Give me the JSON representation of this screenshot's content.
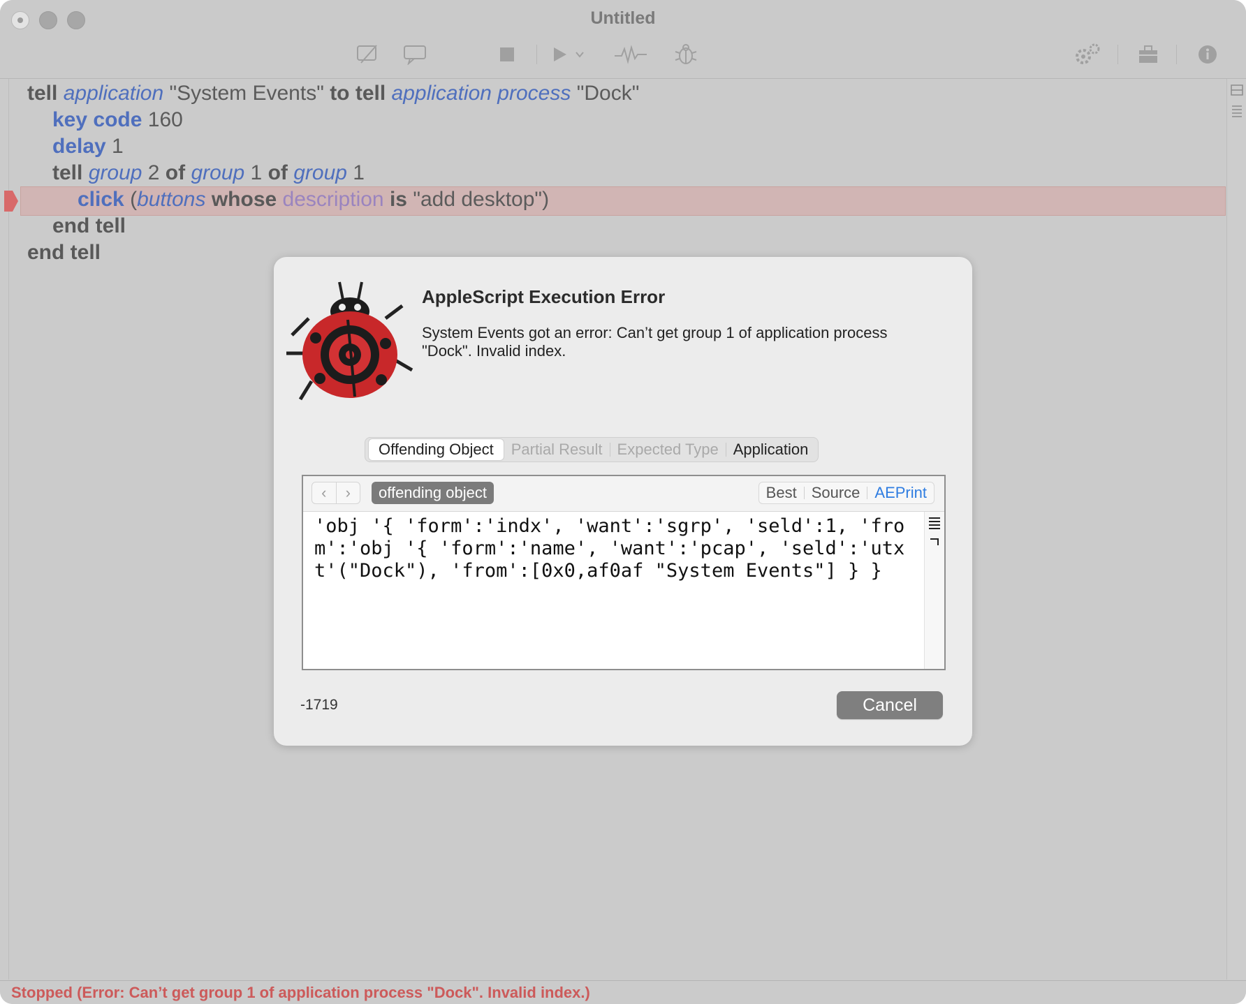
{
  "window": {
    "title": "Untitled"
  },
  "toolbar": {
    "icons": [
      "compile-disabled-icon",
      "comment-icon",
      "stop-icon",
      "run-icon",
      "chevron-down-icon",
      "log-icon",
      "bug-icon",
      "gear-icon",
      "bundle-icon",
      "info-icon"
    ]
  },
  "code": {
    "l1": {
      "w1": "tell",
      "w2": "application",
      "w3": " \"System Events\" ",
      "w4": "to tell",
      "w5": "application process",
      "w6": " \"Dock\""
    },
    "l2": {
      "w1": "key code",
      "w2": " 160"
    },
    "l3": {
      "w1": "delay",
      "w2": " 1"
    },
    "l4": {
      "w1": "tell",
      "w2": "group",
      "w3": " 2 ",
      "w4": "of",
      "w5": "group",
      "w6": " 1 ",
      "w7": "of",
      "w8": "group",
      "w9": " 1"
    },
    "l5": {
      "w1": "click",
      "w2": " (",
      "w3": "buttons",
      "w4": "whose",
      "w5": "description",
      "w6": "is",
      "w7": " \"add desktop\")"
    },
    "l6": {
      "w1": "end tell"
    },
    "l7": {
      "w1": "end tell"
    }
  },
  "dialog": {
    "title": "AppleScript Execution Error",
    "message": "System Events got an error: Can’t get group 1 of application process \"Dock\". Invalid index.",
    "tabs": [
      "Offending Object",
      "Partial Result",
      "Expected Type",
      "Application"
    ],
    "inspector": {
      "pill": "offending object",
      "views": [
        "Best",
        "Source",
        "AEPrint"
      ],
      "content": "'obj '{ 'form':'indx', 'want':'sgrp', 'seld':1, 'from':'obj '{ 'form':'name', 'want':'pcap', 'seld':'utxt'(\"Dock\"), 'from':[0x0,af0af \"System Events\"] } }"
    },
    "error_code": "-1719",
    "cancel": "Cancel"
  },
  "status": "Stopped (Error: Can’t get group 1 of application process \"Dock\". Invalid index.)",
  "colors": {
    "keyword_blue": "#4f6fbd",
    "error_red": "#cc5a5a",
    "highlight": "#d1b5b4"
  }
}
